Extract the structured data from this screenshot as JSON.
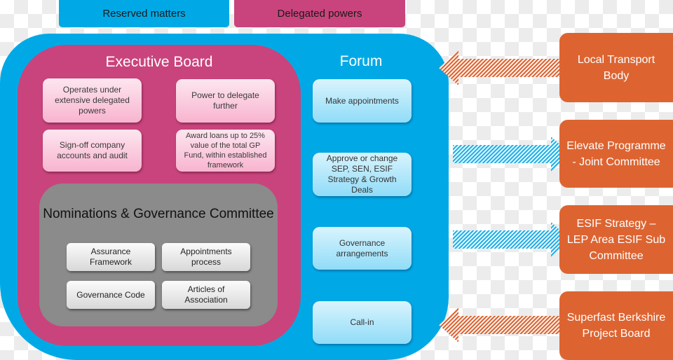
{
  "colors": {
    "reserved_blue": "#00a9e6",
    "delegated_magenta": "#c9447c",
    "executive_board": "#c9447c",
    "committee_grey": "#8a8b8a",
    "external_orange": "#dd6431"
  },
  "legend": {
    "reserved": "Reserved matters",
    "delegated": "Delegated powers"
  },
  "executive_board": {
    "title": "Executive Board",
    "powers": [
      "Operates under extensive delegated powers",
      "Power to delegate further",
      "Sign-off company accounts and audit",
      "Award loans up to 25% value of the total GP Fund, within established framework"
    ]
  },
  "committee": {
    "title": "Nominations & Governance Committee",
    "items": [
      "Assurance Framework",
      "Appointments process",
      "Governance Code",
      "Articles of Association"
    ]
  },
  "forum": {
    "title": "Forum",
    "items": [
      "Make appointments",
      "Approve or change SEP, SEN, ESIF Strategy & Growth Deals",
      "Governance arrangements",
      "Call-in"
    ]
  },
  "external_bodies": [
    {
      "label": "Local Transport Body",
      "arrow": "inbound",
      "arrow_color": "orange"
    },
    {
      "label": "Elevate Programme - Joint Committee",
      "arrow": "outbound",
      "arrow_color": "blue"
    },
    {
      "label": "ESIF Strategy – LEP Area ESIF Sub Committee",
      "arrow": "outbound",
      "arrow_color": "blue"
    },
    {
      "label": "Superfast Berkshire Project Board",
      "arrow": "inbound",
      "arrow_color": "orange"
    }
  ]
}
